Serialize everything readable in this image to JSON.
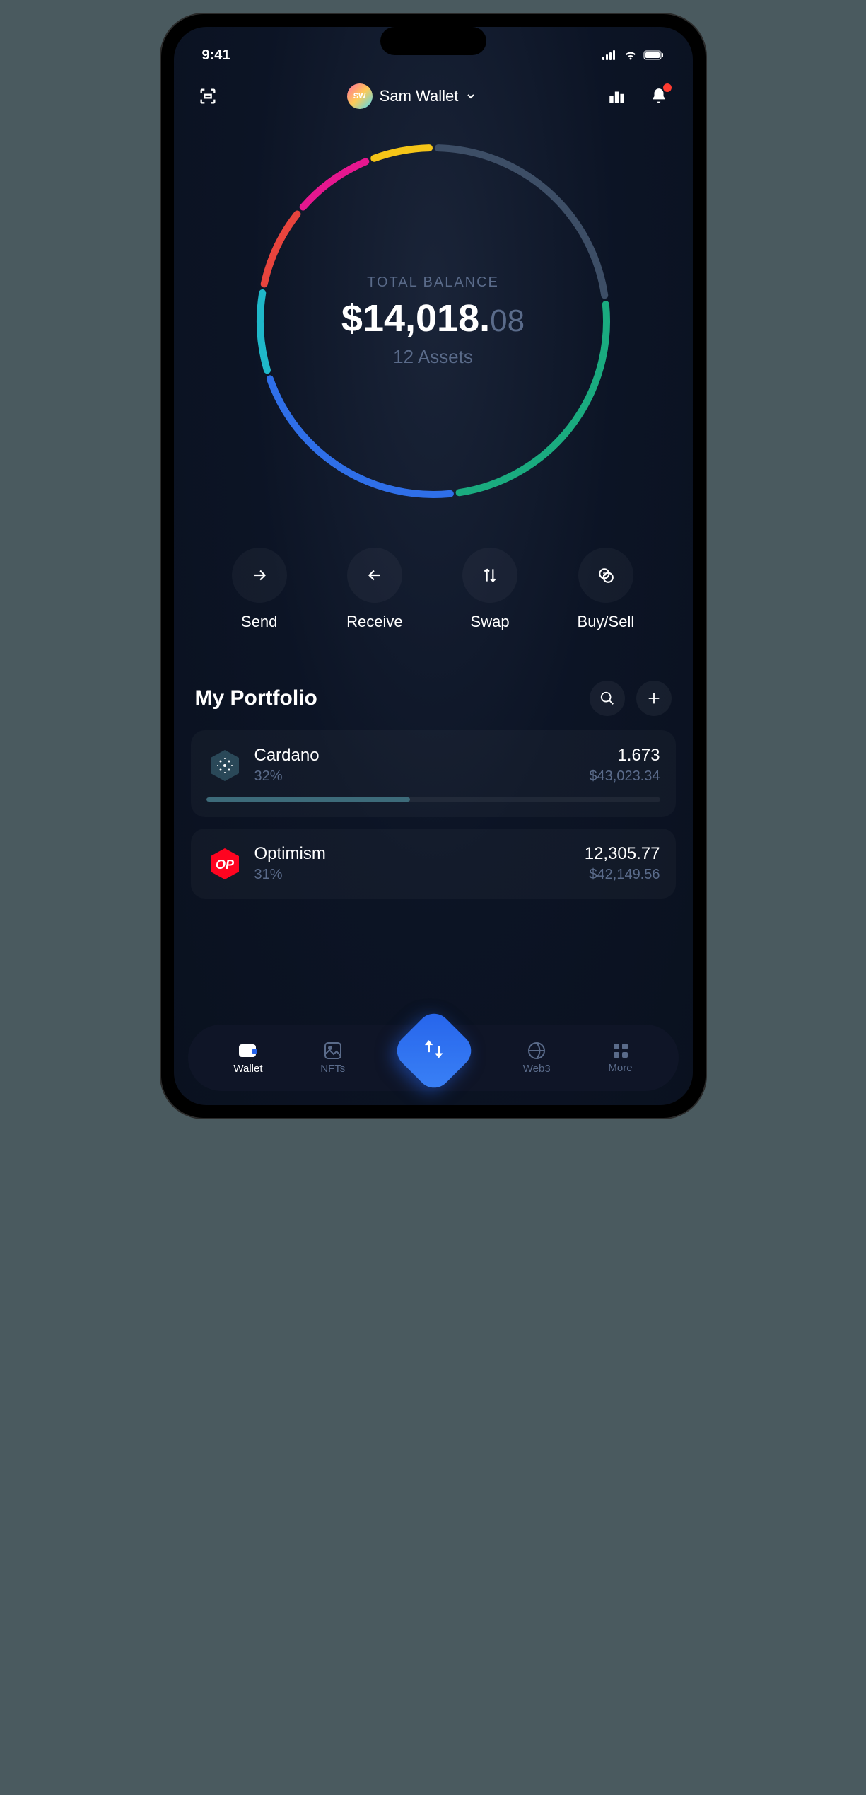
{
  "status": {
    "time": "9:41"
  },
  "header": {
    "avatar_initials": "SW",
    "wallet_name": "Sam Wallet"
  },
  "balance": {
    "label": "TOTAL BALANCE",
    "whole": "$14,018.",
    "cents": "08",
    "assets_count": "12 Assets"
  },
  "chart_data": {
    "type": "pie",
    "title": "Portfolio allocation",
    "series": [
      {
        "name": "yellow",
        "value": 6,
        "color": "#f5c518"
      },
      {
        "name": "slate",
        "value": 23,
        "color": "#3d4e66"
      },
      {
        "name": "green",
        "value": 25,
        "color": "#1aab7f"
      },
      {
        "name": "blue",
        "value": 22,
        "color": "#2f6fe8"
      },
      {
        "name": "cyan",
        "value": 8,
        "color": "#1fb8c9"
      },
      {
        "name": "red",
        "value": 8,
        "color": "#e8443d"
      },
      {
        "name": "magenta",
        "value": 8,
        "color": "#e6178f"
      }
    ]
  },
  "actions": [
    {
      "label": "Send",
      "icon": "arrow-right"
    },
    {
      "label": "Receive",
      "icon": "arrow-left"
    },
    {
      "label": "Swap",
      "icon": "arrows-updown"
    },
    {
      "label": "Buy/Sell",
      "icon": "coin-stack"
    }
  ],
  "portfolio": {
    "title": "My Portfolio",
    "assets": [
      {
        "name": "Cardano",
        "pct": "32%",
        "amount": "1.673",
        "fiat": "$43,023.34",
        "bar_pct": 45,
        "bar_color": "#3d6b7a"
      },
      {
        "name": "Optimism",
        "pct": "31%",
        "amount": "12,305.77",
        "fiat": "$42,149.56",
        "bar_pct": 0,
        "bar_color": "#ff0420"
      }
    ]
  },
  "tabs": [
    {
      "label": "Wallet",
      "active": true
    },
    {
      "label": "NFTs",
      "active": false
    },
    {
      "label": "Web3",
      "active": false
    },
    {
      "label": "More",
      "active": false
    }
  ]
}
